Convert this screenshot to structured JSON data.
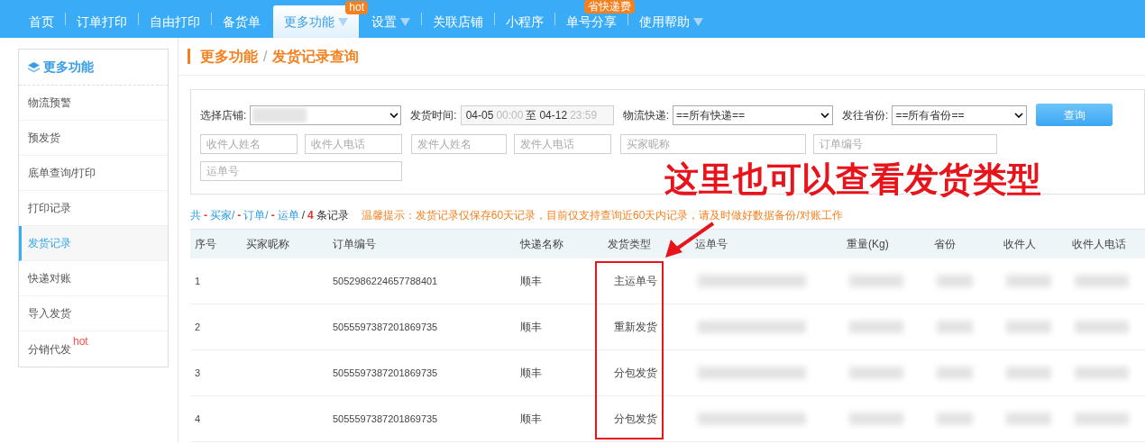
{
  "nav": {
    "items": [
      {
        "label": "首页",
        "selected": false,
        "dropdown": false
      },
      {
        "label": "订单打印",
        "selected": false,
        "dropdown": false
      },
      {
        "label": "自由打印",
        "selected": false,
        "dropdown": false
      },
      {
        "label": "备货单",
        "selected": false,
        "dropdown": false
      },
      {
        "label": "更多功能",
        "selected": true,
        "dropdown": true,
        "badge": "hot"
      },
      {
        "label": "设置",
        "selected": false,
        "dropdown": true
      },
      {
        "label": "关联店铺",
        "selected": false,
        "dropdown": false
      },
      {
        "label": "小程序",
        "selected": false,
        "dropdown": false
      },
      {
        "label": "单号分享",
        "selected": false,
        "dropdown": false,
        "badge": "省快递费"
      },
      {
        "label": "使用帮助",
        "selected": false,
        "dropdown": true
      }
    ]
  },
  "sidebar": {
    "title": "更多功能",
    "items": [
      {
        "label": "物流预警",
        "selected": false
      },
      {
        "label": "预发货",
        "selected": false
      },
      {
        "label": "底单查询/打印",
        "selected": false
      },
      {
        "label": "打印记录",
        "selected": false
      },
      {
        "label": "发货记录",
        "selected": true
      },
      {
        "label": "快递对账",
        "selected": false
      },
      {
        "label": "导入发货",
        "selected": false
      },
      {
        "label": "分销代发",
        "selected": false,
        "badge": "hot"
      }
    ]
  },
  "breadcrumb": [
    "更多功能",
    "/",
    "发货记录查询"
  ],
  "filters": {
    "store_label": "选择店铺:",
    "time_label": "发货时间:",
    "time": {
      "start_date": "04-05",
      "start_time": "00:00",
      "separator": "至",
      "end_date": "04-12",
      "end_time": "23:59"
    },
    "courier_label": "物流快递:",
    "courier_value": "==所有快递==",
    "province_label": "发往省份:",
    "province_value": "==所有省份==",
    "search_button": "查询",
    "fields": [
      {
        "placeholder": "收件人姓名"
      },
      {
        "placeholder": "收件人电话"
      },
      {
        "placeholder": "发件人姓名"
      },
      {
        "placeholder": "发件人电话"
      },
      {
        "placeholder": "买家昵称"
      },
      {
        "placeholder": "订单编号"
      },
      {
        "placeholder": "运单号"
      }
    ]
  },
  "summary": [
    {
      "text": "共",
      "kind": "label"
    },
    {
      "text": "-",
      "kind": "count"
    },
    {
      "text": "买家/",
      "kind": "label"
    },
    {
      "text": "-",
      "kind": "count"
    },
    {
      "text": "订单/",
      "kind": "label"
    },
    {
      "text": "-",
      "kind": "count"
    },
    {
      "text": "运单",
      "kind": "label"
    },
    {
      "text": "/",
      "kind": "plain"
    },
    {
      "text": "4",
      "kind": "count"
    },
    {
      "text": "条记录",
      "kind": "plain"
    }
  ],
  "tip": "温馨提示：发货记录仅保存60天记录，目前仅支持查询近60天内记录，请及时做好数据备份/对账工作",
  "table": {
    "columns": [
      "序号",
      "买家昵称",
      "订单编号",
      "快递名称",
      "发货类型",
      "运单号",
      "重量(Kg)",
      "省份",
      "收件人",
      "收件人电话"
    ],
    "rows": [
      {
        "index": "1",
        "order_no": "5052986224657788401",
        "courier": "顺丰",
        "ship_type": "主运单号"
      },
      {
        "index": "2",
        "order_no": "5055597387201869735",
        "courier": "顺丰",
        "ship_type": "重新发货"
      },
      {
        "index": "3",
        "order_no": "5055597387201869735",
        "courier": "顺丰",
        "ship_type": "分包发货"
      },
      {
        "index": "4",
        "order_no": "5055597387201869735",
        "courier": "顺丰",
        "ship_type": "分包发货"
      }
    ]
  },
  "annotation": {
    "text": "这里也可以查看发货类型"
  }
}
